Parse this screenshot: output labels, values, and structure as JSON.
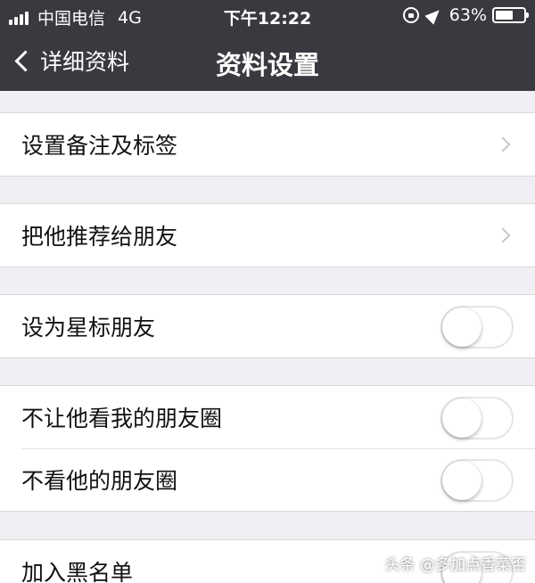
{
  "status_bar": {
    "carrier": "中国电信",
    "network": "4G",
    "time": "下午12:22",
    "battery_text": "63%",
    "battery_level": 0.63
  },
  "nav": {
    "back_label": "详细资料",
    "title": "资料设置"
  },
  "rows": {
    "remark_tags": {
      "label": "设置备注及标签"
    },
    "recommend": {
      "label": "把他推荐给朋友"
    },
    "star_friend": {
      "label": "设为星标朋友",
      "on": false
    },
    "hide_my_moments": {
      "label": "不让他看我的朋友圈",
      "on": false
    },
    "hide_his_moments": {
      "label": "不看他的朋友圈",
      "on": false
    },
    "blacklist": {
      "label": "加入黑名单",
      "on": false
    }
  },
  "watermark": "头条 @多加点香菜否",
  "colors": {
    "header_bg": "#393a3f",
    "page_bg": "#efeff4",
    "toggle_off_border": "#e5e5ea",
    "chevron": "#c7c7cc"
  }
}
